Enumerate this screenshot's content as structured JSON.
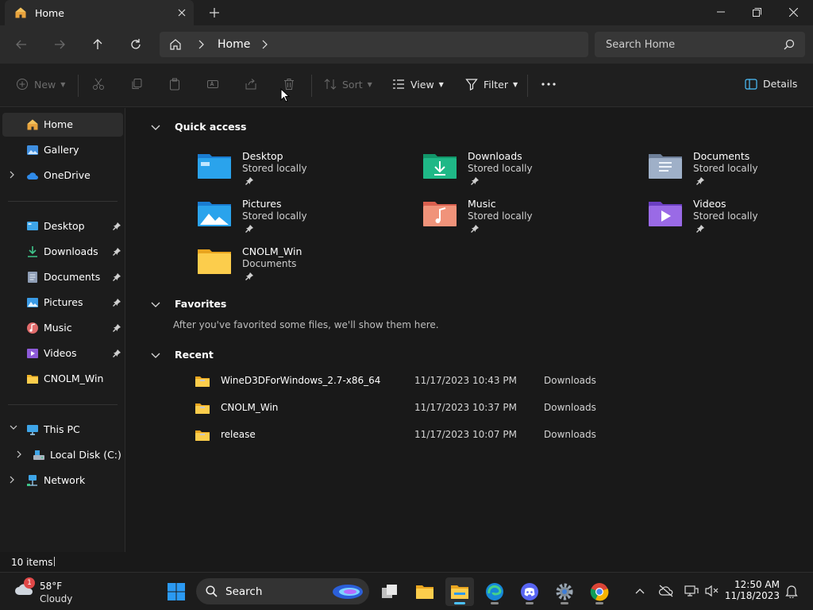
{
  "window": {
    "tab_title": "Home",
    "colors": {
      "titlebar": "#202020",
      "accent": "#4cc2ff",
      "background": "#191919"
    }
  },
  "navigation": {
    "breadcrumb": [
      "Home"
    ],
    "search_placeholder": "Search Home"
  },
  "toolbar": {
    "new_label": "New",
    "sort_label": "Sort",
    "view_label": "View",
    "filter_label": "Filter",
    "details_label": "Details"
  },
  "sidebar": {
    "top": [
      {
        "label": "Home",
        "icon": "home-icon",
        "selected": true
      },
      {
        "label": "Gallery",
        "icon": "gallery-icon"
      },
      {
        "label": "OneDrive",
        "icon": "onedrive-icon"
      }
    ],
    "pinned": [
      {
        "label": "Desktop",
        "icon": "desktop-icon"
      },
      {
        "label": "Downloads",
        "icon": "downloads-icon"
      },
      {
        "label": "Documents",
        "icon": "documents-icon"
      },
      {
        "label": "Pictures",
        "icon": "pictures-icon"
      },
      {
        "label": "Music",
        "icon": "music-icon"
      },
      {
        "label": "Videos",
        "icon": "videos-icon"
      },
      {
        "label": "CNOLM_Win",
        "icon": "folder-icon"
      }
    ],
    "devices": [
      {
        "label": "This PC",
        "icon": "pc-icon"
      },
      {
        "label": "Local Disk (C:)",
        "icon": "disk-icon"
      },
      {
        "label": "Network",
        "icon": "network-icon"
      }
    ]
  },
  "quick_access": {
    "title": "Quick access",
    "items": [
      {
        "name": "Desktop",
        "sub": "Stored locally"
      },
      {
        "name": "Downloads",
        "sub": "Stored locally"
      },
      {
        "name": "Documents",
        "sub": "Stored locally"
      },
      {
        "name": "Pictures",
        "sub": "Stored locally"
      },
      {
        "name": "Music",
        "sub": "Stored locally"
      },
      {
        "name": "Videos",
        "sub": "Stored locally"
      },
      {
        "name": "CNOLM_Win",
        "sub": "Documents"
      }
    ]
  },
  "favorites": {
    "title": "Favorites",
    "empty_text": "After you've favorited some files, we'll show them here."
  },
  "recent": {
    "title": "Recent",
    "items": [
      {
        "name": "WineD3DForWindows_2.7-x86_64",
        "date": "11/17/2023 10:43 PM",
        "location": "Downloads"
      },
      {
        "name": "CNOLM_Win",
        "date": "11/17/2023 10:37 PM",
        "location": "Downloads"
      },
      {
        "name": "release",
        "date": "11/17/2023 10:07 PM",
        "location": "Downloads"
      }
    ]
  },
  "status": {
    "item_count": "10 items"
  },
  "taskbar": {
    "weather_temp": "58°F",
    "weather_cond": "Cloudy",
    "weather_badge": "1",
    "search_label": "Search",
    "time": "12:50 AM",
    "date": "11/18/2023"
  }
}
